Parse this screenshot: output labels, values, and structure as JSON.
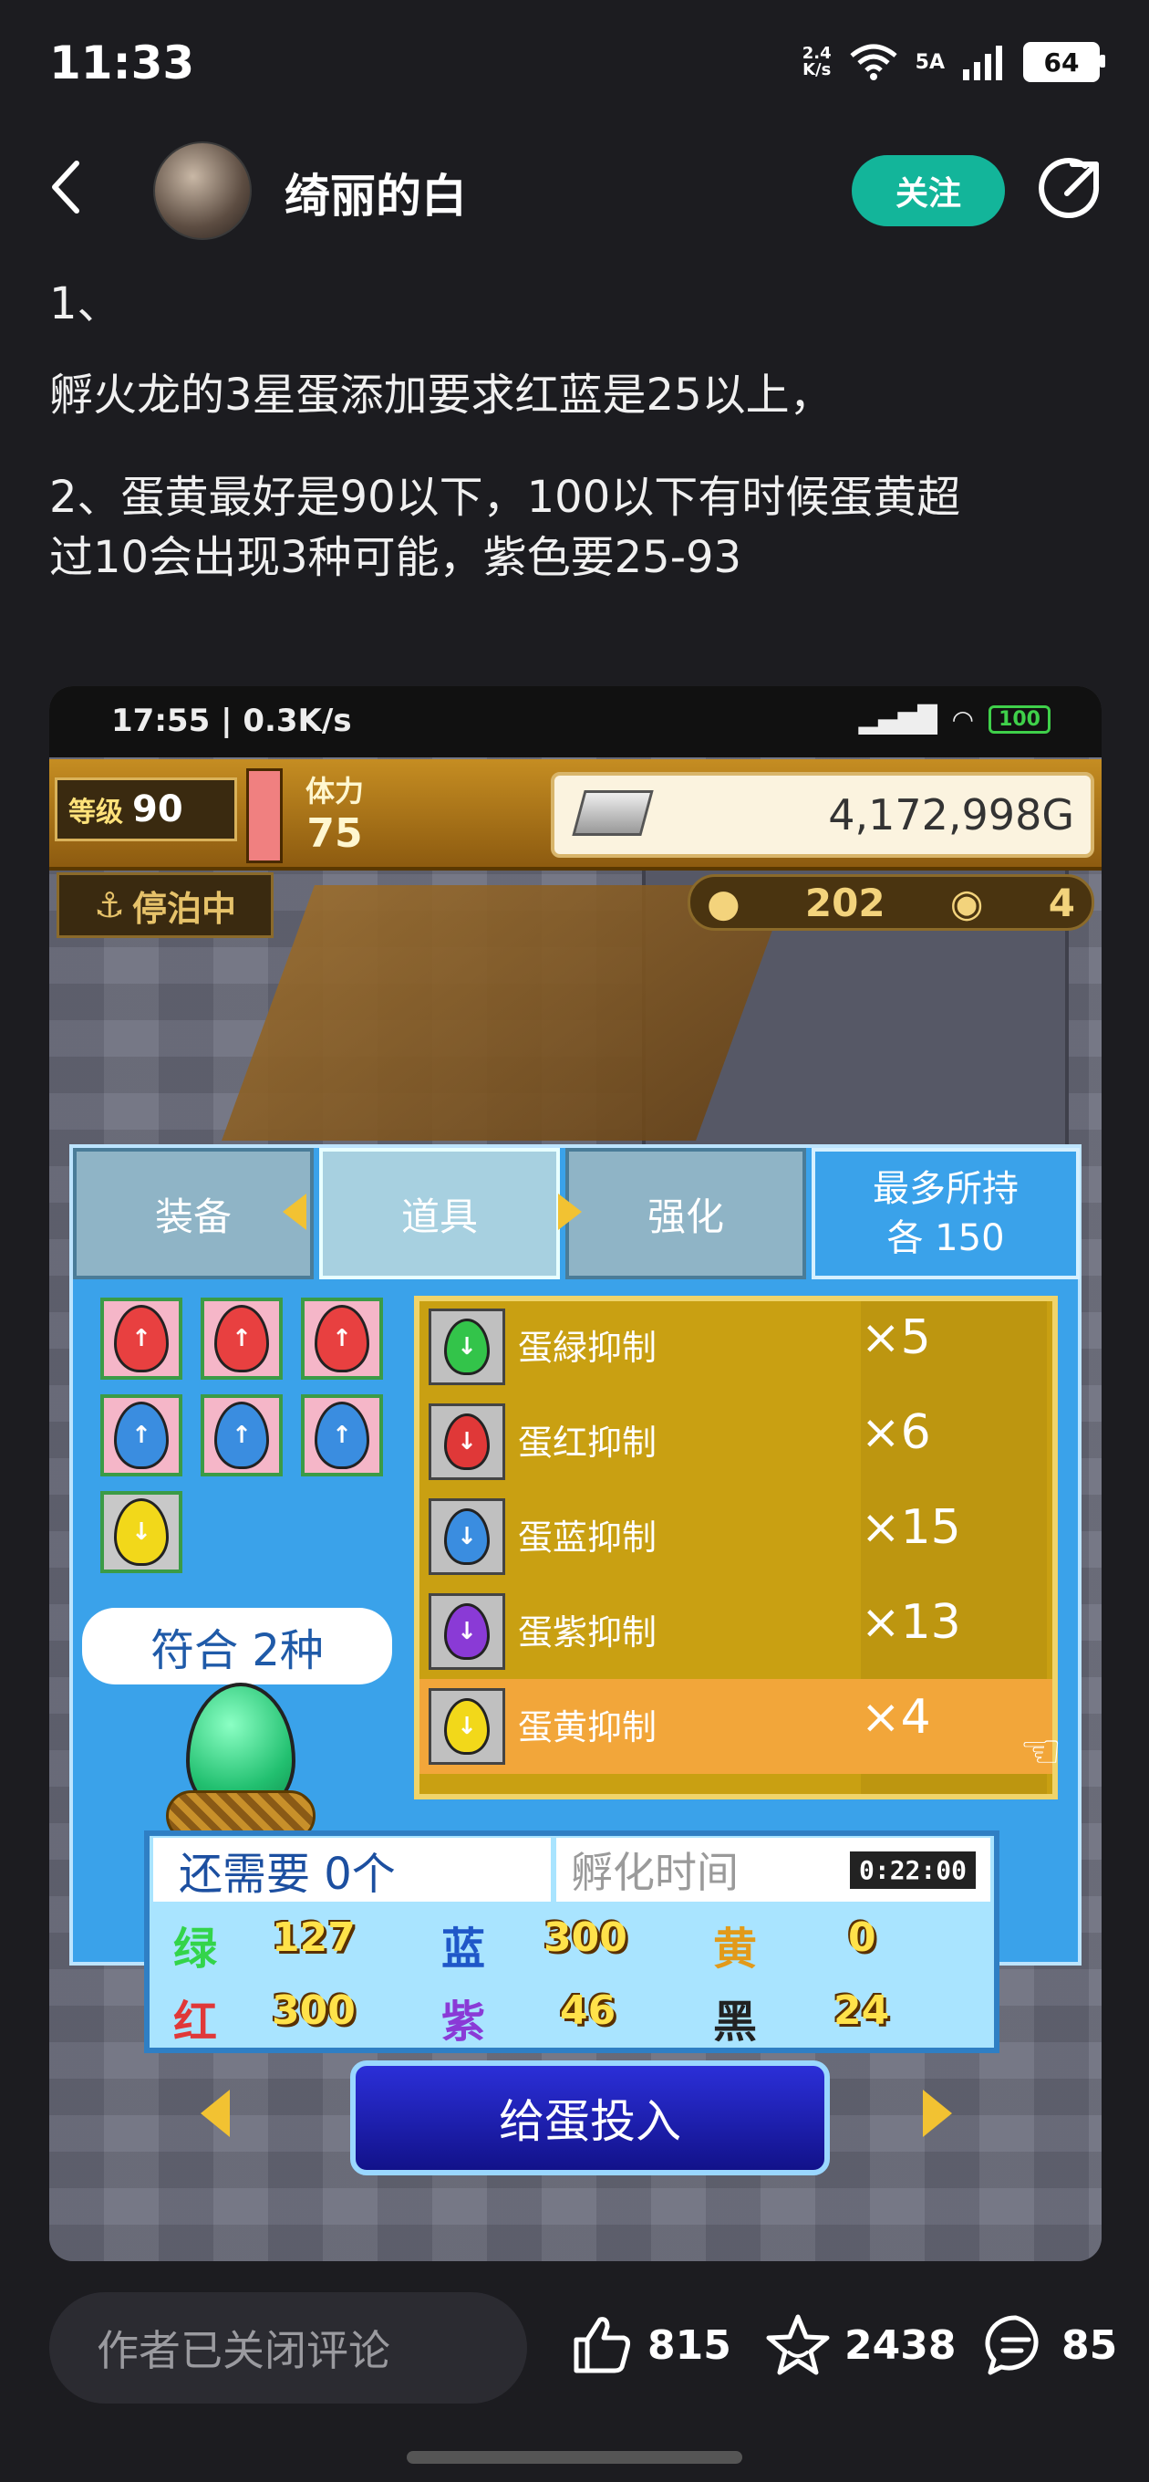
{
  "status_bar": {
    "time": "11:33",
    "net_speed_top": "2.4",
    "net_speed_bottom": "K/s",
    "signal_text": "5A",
    "battery": "64"
  },
  "header": {
    "author": "绮丽的白",
    "follow_label": "关注"
  },
  "post": {
    "line1": "1、",
    "line2": "孵火龙的3星蛋添加要求红蓝是25以上，",
    "line3a": "2、蛋黄最好是90以下，100以下有时候蛋黄超",
    "line3b": "过10会出现3种可能，紫色要25-93"
  },
  "game": {
    "status": {
      "time": "17:55 | 0.3K/s",
      "battery": "100"
    },
    "level_label": "等级",
    "level": "90",
    "stamina_label": "体力",
    "stamina": "75",
    "gold": "4,172,998G",
    "docked": "停泊中",
    "resource_a": "202",
    "resource_b": "4",
    "tabs": {
      "equip": "装备",
      "item": "道具",
      "enhance": "强化",
      "max_line1": "最多所持",
      "max_line2": "各 150"
    },
    "items": [
      {
        "name": "蛋緑抑制",
        "qty": "×5",
        "color": "#33c44a"
      },
      {
        "name": "蛋红抑制",
        "qty": "×6",
        "color": "#e03838"
      },
      {
        "name": "蛋蓝抑制",
        "qty": "×15",
        "color": "#3a8de0"
      },
      {
        "name": "蛋紫抑制",
        "qty": "×13",
        "color": "#8a3ad6"
      },
      {
        "name": "蛋黄抑制",
        "qty": "×4",
        "color": "#f2d81a"
      }
    ],
    "match_text": "符合 2种",
    "need_text": "还需要 0个",
    "hatch_label": "孵化时间",
    "hatch_time": "0:22:00",
    "stats": {
      "green_label": "绿",
      "green": "127",
      "blue_label": "蓝",
      "blue": "300",
      "yellow_label": "黄",
      "yellow": "0",
      "red_label": "红",
      "red": "300",
      "purple_label": "紫",
      "purple": "46",
      "black_label": "黑",
      "black": "24"
    },
    "feed_button": "给蛋投入"
  },
  "bottom_bar": {
    "comment_placeholder": "作者已关闭评论",
    "likes": "815",
    "favorites": "2438",
    "comments": "85"
  },
  "colors": {
    "accent": "#13b59a",
    "background": "#1c1c20"
  }
}
